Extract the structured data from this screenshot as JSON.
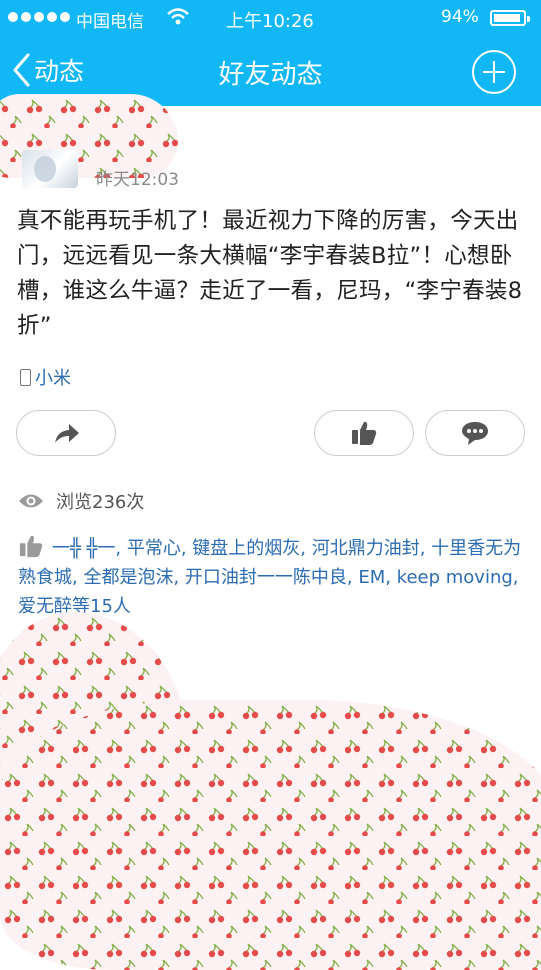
{
  "status_bar": {
    "carrier": "中国电信",
    "time": "上午10:26",
    "battery_percent": "94%",
    "battery_level": 0.94
  },
  "nav": {
    "back_label": "动态",
    "title": "好友动态"
  },
  "post": {
    "time": "昨天12:03",
    "text": "真不能再玩手机了！最近视力下降的厉害，今天出门，远远看见一条大横幅“李宇春装B拉”！心想卧槽，谁这么牛逼？走近了一看，尼玛，“李宁春装8折”",
    "device": "小米"
  },
  "stats": {
    "views": "浏览236次",
    "likes": "一╬ ╬一, 平常心, 键盘上的烟灰, 河北鼎力油封, 十里香无为熟食城, 全都是泡沫, 开口油封一一陈中良, EM, keep moving, 爱无醉等15人"
  },
  "colors": {
    "header_bg": "#12b7f5",
    "link_blue": "#2c6cb2",
    "pattern_red": "#e64b4b"
  }
}
